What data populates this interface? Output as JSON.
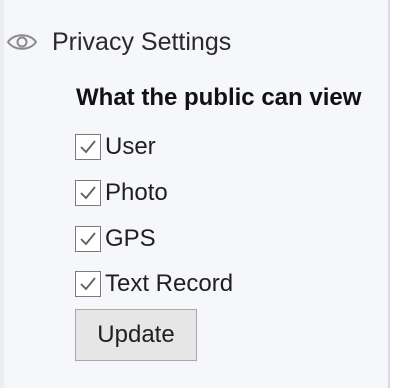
{
  "section": {
    "title": "Privacy Settings",
    "icon": "eye-icon"
  },
  "group": {
    "title": "What the public can view"
  },
  "options": [
    {
      "label": "User",
      "checked": true
    },
    {
      "label": "Photo",
      "checked": true
    },
    {
      "label": "GPS",
      "checked": true
    },
    {
      "label": "Text Record",
      "checked": true
    }
  ],
  "actions": {
    "update_label": "Update"
  },
  "colors": {
    "panel_background": "#f6f7fa",
    "checkbox_border": "#7a7a7a",
    "button_background": "#e6e6e6"
  }
}
